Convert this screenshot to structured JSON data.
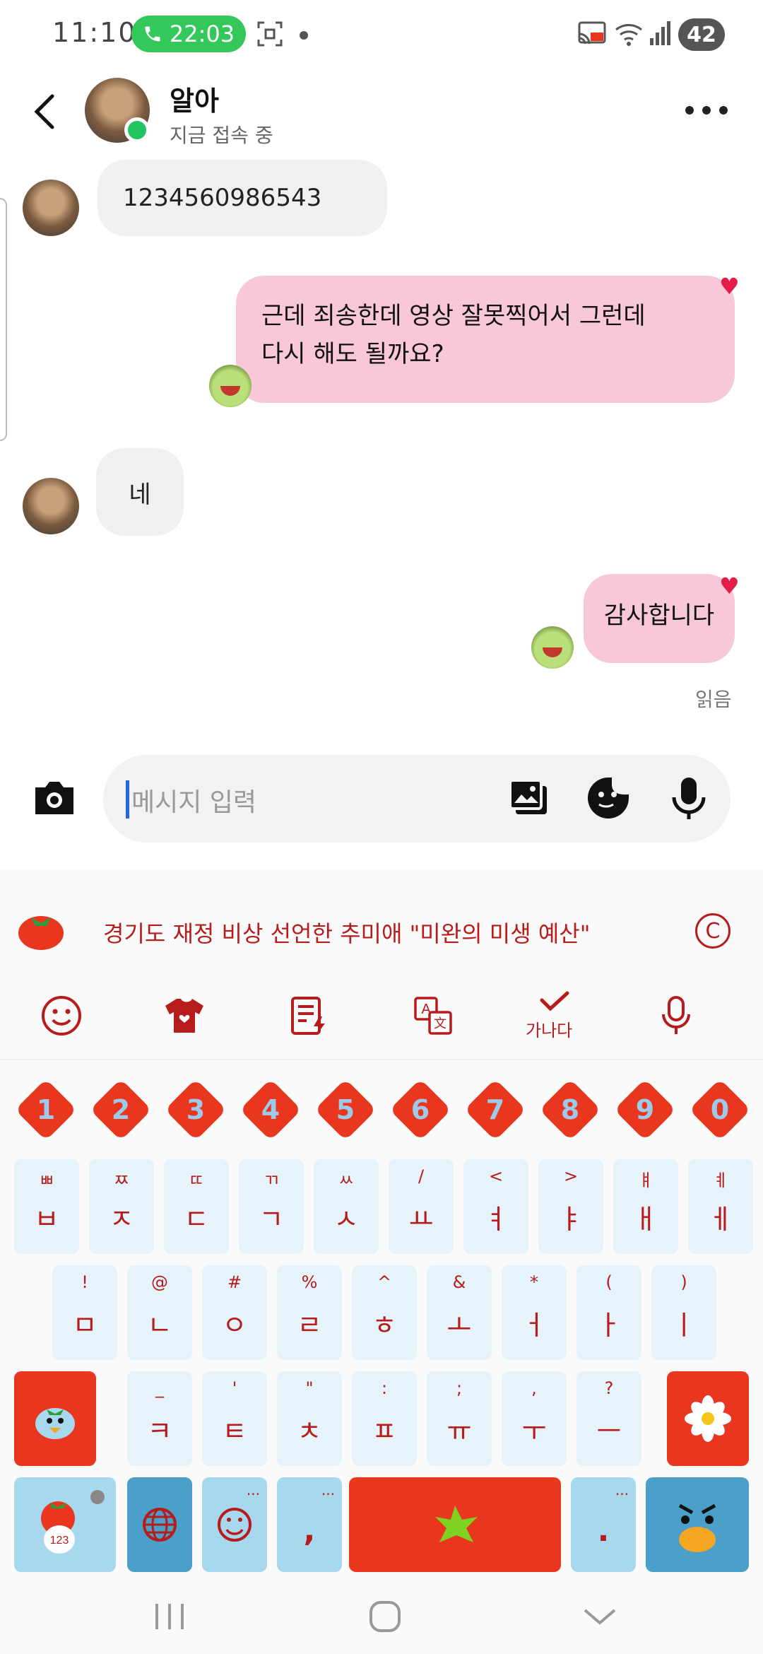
{
  "status_bar": {
    "time": "11:10",
    "call_duration": "22:03",
    "battery": "42"
  },
  "header": {
    "contact_name": "알아",
    "status": "지금 접속 중"
  },
  "messages": [
    {
      "from": "them",
      "text": "1234560986543"
    },
    {
      "from": "me",
      "line1": "근데 죄송한데 영상 잘못찍어서 그런데",
      "line2": "다시 해도 될까요?"
    },
    {
      "from": "them",
      "text": "네"
    },
    {
      "from": "me",
      "text": "감사합니다"
    }
  ],
  "read_receipt": "읽음",
  "composer": {
    "placeholder": "메시지 입력"
  },
  "keyboard": {
    "banner_text": "경기도 재정 비상 선언한 추미애 \"미완의 미생 예산\"",
    "copy_icon_label": "C",
    "spell_label": "가나다",
    "numbers": [
      "1",
      "2",
      "3",
      "4",
      "5",
      "6",
      "7",
      "8",
      "9",
      "0"
    ],
    "row1": [
      {
        "main": "ㅂ",
        "sub": "ㅃ"
      },
      {
        "main": "ㅈ",
        "sub": "ㅉ"
      },
      {
        "main": "ㄷ",
        "sub": "ㄸ"
      },
      {
        "main": "ㄱ",
        "sub": "ㄲ"
      },
      {
        "main": "ㅅ",
        "sub": "ㅆ"
      },
      {
        "main": "ㅛ",
        "sub": "/"
      },
      {
        "main": "ㅕ",
        "sub": "<"
      },
      {
        "main": "ㅑ",
        "sub": ">"
      },
      {
        "main": "ㅐ",
        "sub": "ㅒ"
      },
      {
        "main": "ㅔ",
        "sub": "ㅖ"
      }
    ],
    "row2": [
      {
        "main": "ㅁ",
        "sub": "!"
      },
      {
        "main": "ㄴ",
        "sub": "@"
      },
      {
        "main": "ㅇ",
        "sub": "#"
      },
      {
        "main": "ㄹ",
        "sub": "%"
      },
      {
        "main": "ㅎ",
        "sub": "^"
      },
      {
        "main": "ㅗ",
        "sub": "&"
      },
      {
        "main": "ㅓ",
        "sub": "*"
      },
      {
        "main": "ㅏ",
        "sub": "("
      },
      {
        "main": "ㅣ",
        "sub": ")"
      }
    ],
    "row3": [
      {
        "main": "ㅋ",
        "sub": "_"
      },
      {
        "main": "ㅌ",
        "sub": "'"
      },
      {
        "main": "ㅊ",
        "sub": "\""
      },
      {
        "main": "ㅍ",
        "sub": ":"
      },
      {
        "main": "ㅠ",
        "sub": ";"
      },
      {
        "main": "ㅜ",
        "sub": ","
      },
      {
        "main": "ㅡ",
        "sub": "?"
      }
    ],
    "comma_key": ",",
    "period_key": ".",
    "ellipsis": "...",
    "num_mode_label": "123"
  }
}
